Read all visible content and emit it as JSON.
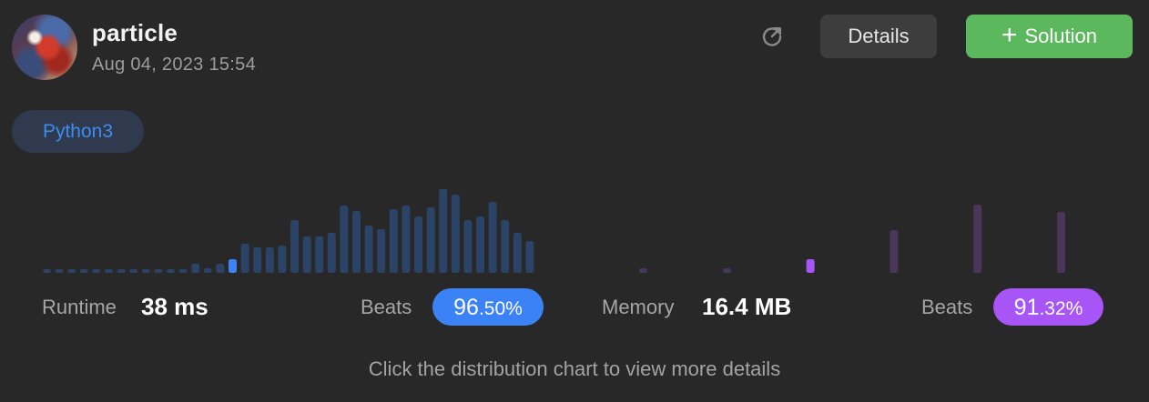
{
  "user": {
    "name": "particle",
    "timestamp": "Aug 04, 2023 15:54"
  },
  "actions": {
    "details_label": "Details",
    "solution_label": "Solution",
    "refresh_icon": "refresh-icon",
    "plus_icon": "plus-icon"
  },
  "language": "Python3",
  "runtime": {
    "label": "Runtime",
    "value": "38 ms",
    "beats_label": "Beats",
    "beats_int": "96",
    "beats_dec": ".50%",
    "accent": "#3b82f6",
    "bar_color": "#2a4366"
  },
  "memory": {
    "label": "Memory",
    "value": "16.4 MB",
    "beats_label": "Beats",
    "beats_int": "91",
    "beats_dec": ".32%",
    "accent": "#a855f7",
    "bar_color": "#4a3658"
  },
  "hint": "Click the distribution chart to view more details",
  "chart_data": [
    {
      "type": "bar",
      "name": "runtime-distribution",
      "values": [
        4,
        4,
        4,
        4,
        4,
        4,
        4,
        4,
        4,
        4,
        4,
        4,
        10,
        5,
        10,
        15,
        32,
        28,
        28,
        30,
        58,
        40,
        40,
        44,
        74,
        68,
        52,
        48,
        70,
        74,
        62,
        72,
        92,
        86,
        58,
        62,
        78,
        58,
        44,
        35
      ],
      "highlight_index": 15
    },
    {
      "type": "bar",
      "name": "memory-distribution",
      "values": [
        5,
        5,
        15,
        47,
        75,
        67
      ],
      "highlight_index": 2
    }
  ]
}
